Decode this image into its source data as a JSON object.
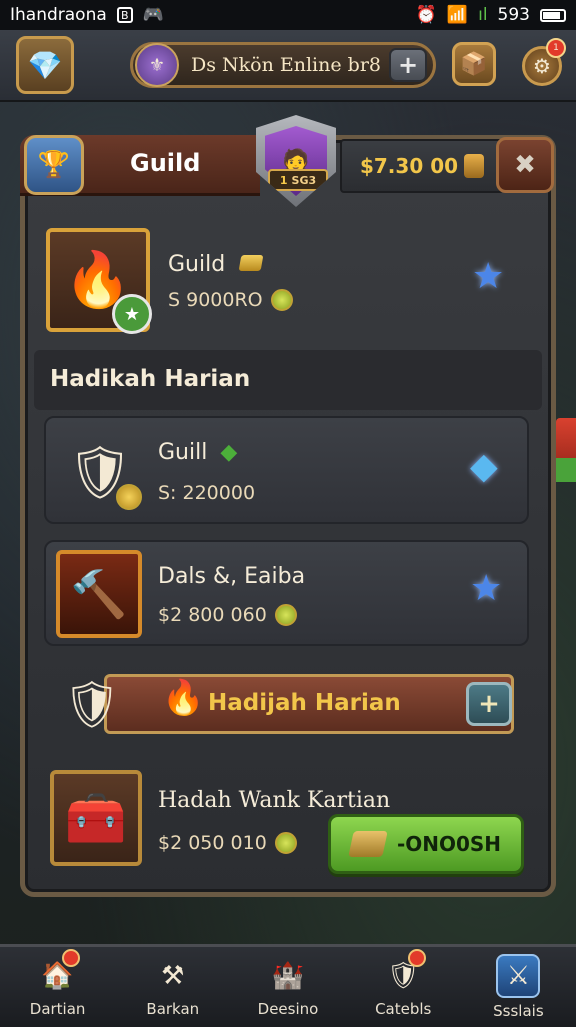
{
  "status_bar": {
    "carrier": "Ihandraona",
    "box_glyph": "B",
    "time": "593"
  },
  "top_bar": {
    "title": "Ds Nkön Enline br8",
    "plus": "+",
    "badge_count": "1"
  },
  "header": {
    "tab_label": "Guild",
    "rank_text": "SG3",
    "rank_level": "1",
    "money": "$7.30 00"
  },
  "featured": {
    "title": "Guild",
    "price": "S 9000RO"
  },
  "section": {
    "title": "Hadikah Harian"
  },
  "items": [
    {
      "title": "Guill",
      "price": "S: 220000"
    },
    {
      "title": "Dals &, Eaiba",
      "price": "$2 800 060"
    }
  ],
  "banner": {
    "label": "Hadijah Harian",
    "add": "+"
  },
  "last_item": {
    "title": "Hadah Wank Kartian",
    "price": "$2 050 010",
    "buy_label": "-ONO0SH"
  },
  "bottom_nav": [
    {
      "label": "Dartian"
    },
    {
      "label": "Barkan"
    },
    {
      "label": "Deesino"
    },
    {
      "label": "Catebls"
    },
    {
      "label": "Ssslais"
    }
  ],
  "colors": {
    "accent_gold": "#f2c64a",
    "buy_green": "#6fbf3a",
    "star_blue": "#4c86e8",
    "panel_border": "#6a5a44"
  }
}
